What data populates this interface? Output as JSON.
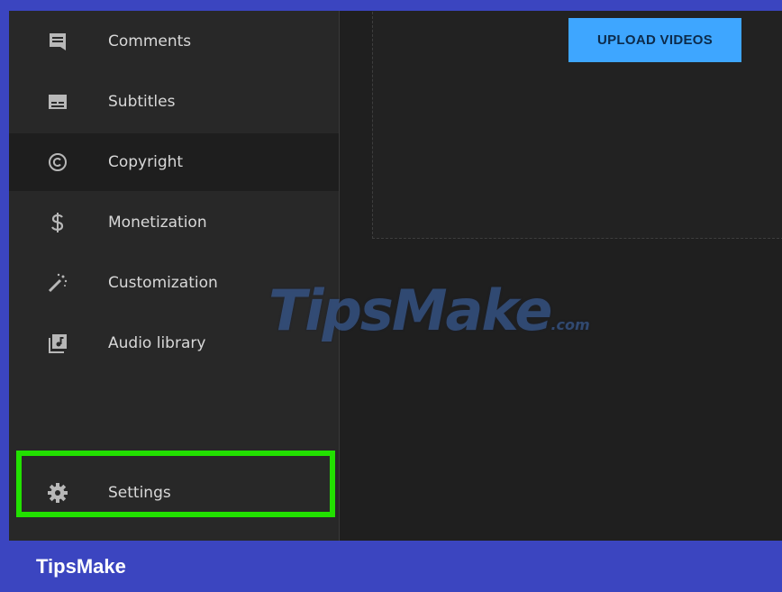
{
  "sidebar": {
    "items": [
      {
        "label": "Comments",
        "icon": "comment-icon"
      },
      {
        "label": "Subtitles",
        "icon": "subtitles-icon"
      },
      {
        "label": "Copyright",
        "icon": "copyright-icon"
      },
      {
        "label": "Monetization",
        "icon": "dollar-icon"
      },
      {
        "label": "Customization",
        "icon": "magic-wand-icon"
      },
      {
        "label": "Audio library",
        "icon": "audio-library-icon"
      },
      {
        "label": "Settings",
        "icon": "gear-icon"
      }
    ]
  },
  "main": {
    "upload_label": "UPLOAD VIDEOS"
  },
  "watermark": {
    "text": "TipsMake",
    "suffix": ".com"
  },
  "footer": {
    "brand": "TipsMake"
  },
  "colors": {
    "accent": "#3ea6ff",
    "highlight": "#22e000",
    "banner": "#3b45c0"
  }
}
